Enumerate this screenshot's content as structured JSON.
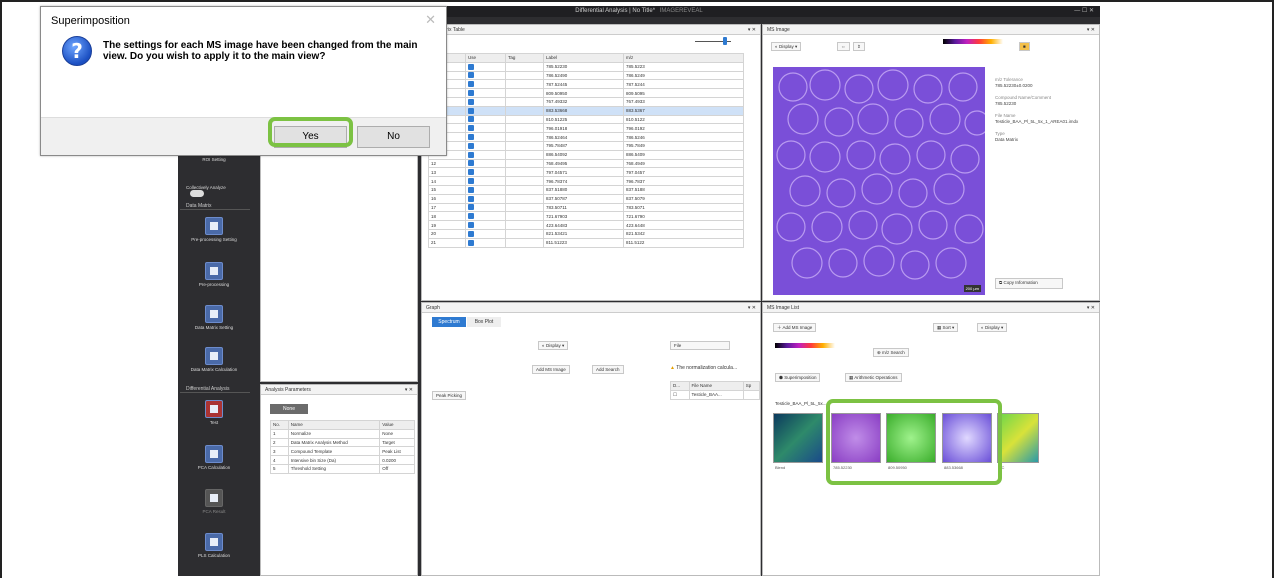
{
  "app": {
    "title": "Differential Analysis | No Title*",
    "title_suffix": "IMAGEREVEAL",
    "window_controls": "— ☐ ✕"
  },
  "dialog": {
    "title": "Superimposition",
    "message": "The settings for each MS image have been changed from the main view. Do you wish to apply it to the main view?",
    "yes_label": "Yes",
    "no_label": "No",
    "close": "✕"
  },
  "leftbar": {
    "roi": "ROI Setting",
    "collective": "Collectively Analyze",
    "data_matrix_head": "Data Matrix",
    "items": [
      "Pre-processing Setting",
      "Pre-processing",
      "Data Matrix Setting",
      "Data Matrix Calculation"
    ],
    "diff_head": "Differential Analysis",
    "diff_items": [
      "Test",
      "PCA Calculation",
      "PCA Result",
      "PLS Calculation"
    ]
  },
  "matrix": {
    "title": "Data Matrix Table",
    "cols": [
      "No.",
      "Use",
      "Tag",
      "Label",
      "m/z"
    ],
    "rows": [
      [
        "1",
        "",
        "",
        "785.52230",
        "785.5223"
      ],
      [
        "2",
        "",
        "",
        "786.52490",
        "786.5249"
      ],
      [
        "3",
        "",
        "",
        "787.52445",
        "787.5244"
      ],
      [
        "4",
        "",
        "",
        "809.50950",
        "809.5095"
      ],
      [
        "5",
        "",
        "",
        "767.49332",
        "767.4933"
      ],
      [
        "6",
        "",
        "",
        "883.53668",
        "883.5367"
      ],
      [
        "7",
        "",
        "",
        "810.51225",
        "810.5122"
      ],
      [
        "8",
        "",
        "",
        "796.01918",
        "796.0192"
      ],
      [
        "9",
        "",
        "",
        "786.52464",
        "786.5246"
      ],
      [
        "10",
        "",
        "",
        "795.78487",
        "795.7849"
      ],
      [
        "11",
        "",
        "",
        "886.54092",
        "886.5409"
      ],
      [
        "12",
        "",
        "",
        "768.49495",
        "768.4949"
      ],
      [
        "13",
        "",
        "",
        "797.04571",
        "797.0457"
      ],
      [
        "14",
        "",
        "",
        "796.78374",
        "796.7837"
      ],
      [
        "15",
        "",
        "",
        "837.51880",
        "837.5188"
      ],
      [
        "16",
        "",
        "",
        "837.50787",
        "837.5079"
      ],
      [
        "17",
        "",
        "",
        "783.50711",
        "783.5071"
      ],
      [
        "18",
        "",
        "",
        "721.67903",
        "721.6790"
      ],
      [
        "19",
        "",
        "",
        "423.64483",
        "423.6448"
      ],
      [
        "20",
        "",
        "",
        "821.53421",
        "821.5342"
      ],
      [
        "21",
        "",
        "",
        "811.51223",
        "811.5122"
      ]
    ],
    "selected_row": 5
  },
  "msimage": {
    "title": "MS Image",
    "display": "Display",
    "scale": "200 µm",
    "props": {
      "mz_label": "m/z Tolerance",
      "mz": "785.52230±0.0200",
      "compound_label": "Compound Name/Comment",
      "compound": "785.52230",
      "file_label": "File Name",
      "file": "Testicle_BAA_Pl_5L_5x_1_AREA01.imdx",
      "type_label": "Type",
      "type": "Data Matrix"
    },
    "copy": "Copy Information"
  },
  "graph": {
    "title": "Graph",
    "tabs": [
      "Spectrum",
      "Box Plot"
    ],
    "display": "Display",
    "add_ms": "Add MS Image",
    "add_search": "Add Search",
    "peak_picking": "Peak Picking",
    "file_label": "File",
    "warning": "The normalization calcula...",
    "cols": [
      "D...",
      "File Name",
      "Sp"
    ],
    "file_row": "Testicle_BAA..."
  },
  "mslist": {
    "title": "MS Image List",
    "add": "Add MS Image",
    "sort": "Sort",
    "display": "Display",
    "mz_search": "m/z Search",
    "superimposition": "Superimposition",
    "arith": "Arithmetic Operations",
    "group": "Testicle_BAA_Pl_5L_5x...",
    "thumbs": [
      "Blend",
      "785.52230",
      "809.50950",
      "883.53668",
      "FC"
    ]
  },
  "params": {
    "title": "Analysis Parameters",
    "none": "None",
    "cols": [
      "No.",
      "Name",
      "Value"
    ],
    "rows": [
      [
        "1",
        "Normalize",
        "None"
      ],
      [
        "2",
        "Data Matrix Analysis Method",
        "Target"
      ],
      [
        "3",
        "Compound Template",
        "Peak List"
      ],
      [
        "4",
        "Intensive bin Size (Da)",
        "0.0200"
      ],
      [
        "5",
        "Threshold Setting",
        "Off"
      ]
    ]
  },
  "colors": {
    "accent": "#2e7ad1",
    "highlight": "#7cc243",
    "dark": "#2d2d30"
  }
}
